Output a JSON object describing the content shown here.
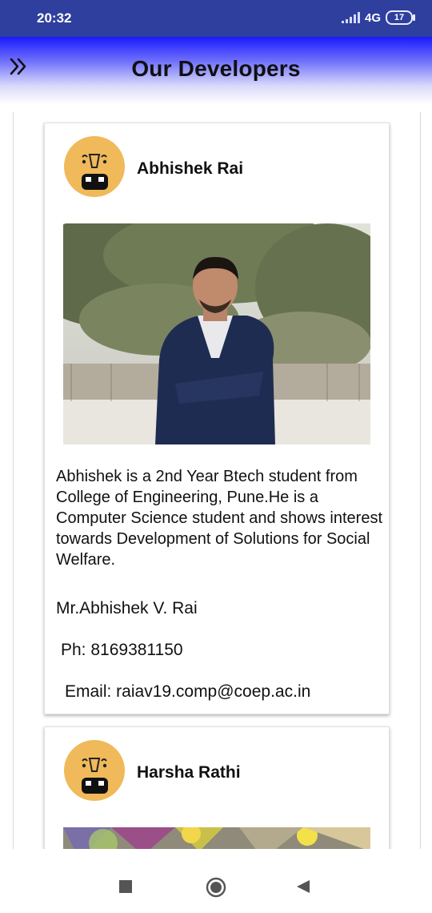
{
  "status_bar": {
    "time": "20:32",
    "network": "4G",
    "battery": "17"
  },
  "header": {
    "title": "Our Developers",
    "menu_icon": "double-chevron-right-icon"
  },
  "developers": [
    {
      "name": "Abhishek Rai",
      "bio": "Abhishek is a 2nd Year Btech student from College of Engineering, Pune.He is a Computer Science student and shows interest towards Development of Solutions for Social Welfare.",
      "full_name": "Mr.Abhishek V. Rai",
      "phone": "Ph:  8169381150",
      "email": "Email:  raiav19.comp@coep.ac.in"
    },
    {
      "name": "Harsha Rathi"
    }
  ],
  "colors": {
    "status_bar": "#2f3f9e",
    "header_gradient_top": "#1a1aff",
    "avatar_yellow": "#f0b95a"
  },
  "navigation": {
    "recents": "square-icon",
    "home": "circle-home-icon",
    "back": "triangle-back-icon"
  }
}
